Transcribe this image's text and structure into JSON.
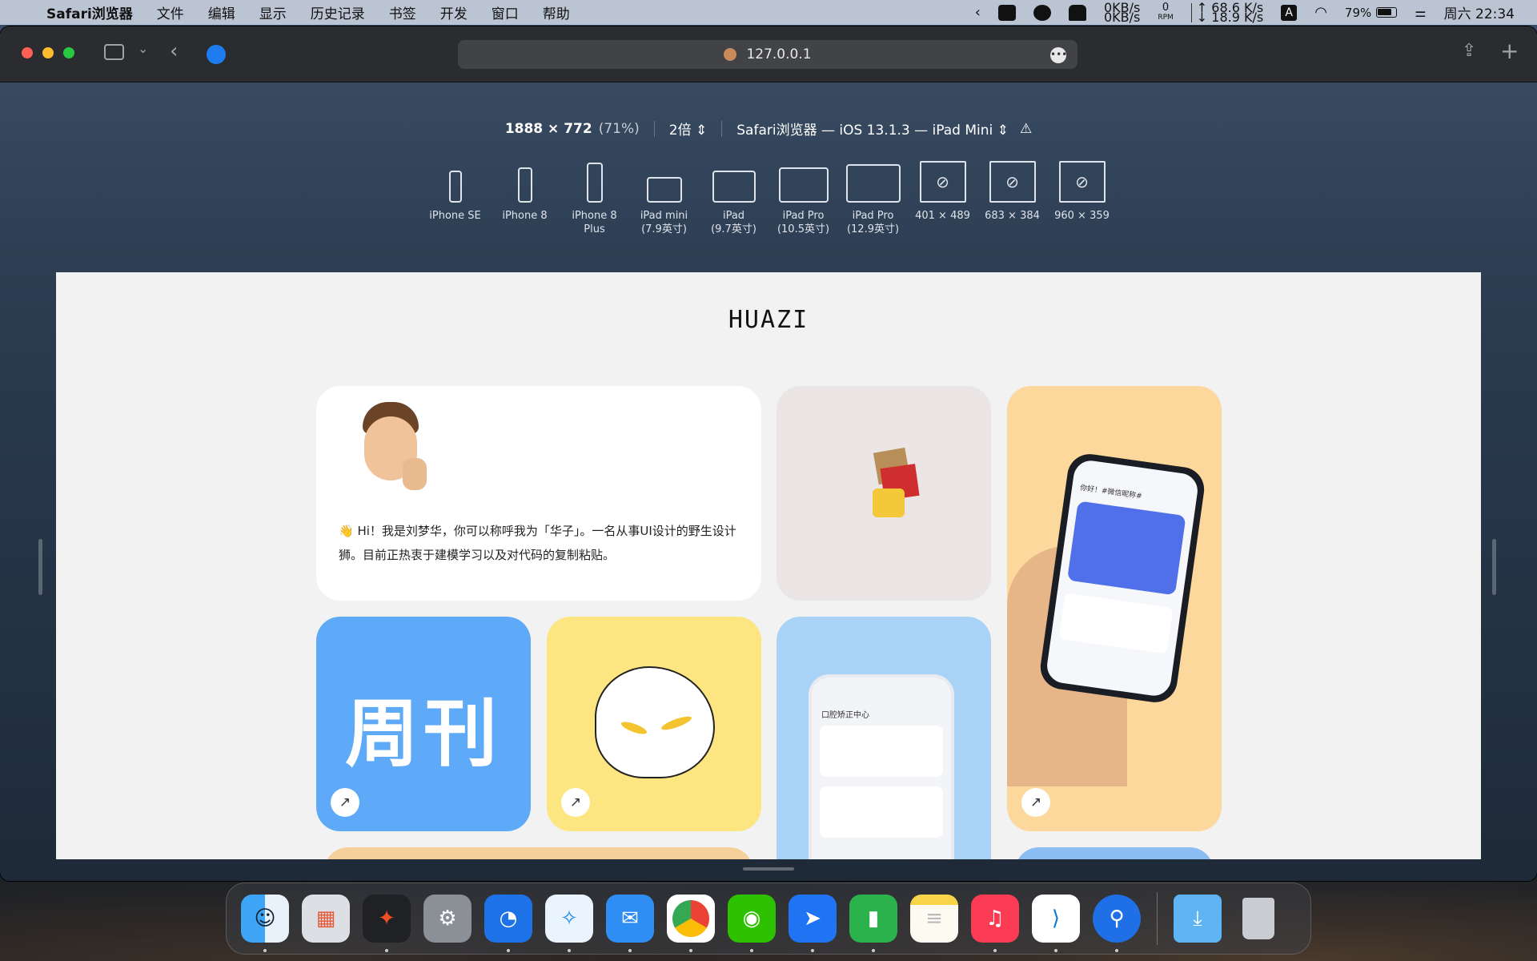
{
  "menubar": {
    "app_name": "Safari浏览器",
    "items": [
      "文件",
      "编辑",
      "显示",
      "历史记录",
      "书签",
      "开发",
      "窗口",
      "帮助"
    ],
    "net_up": "0KB/s",
    "net_down": "0KB/s",
    "fan_value": "0",
    "fan_unit": "RPM",
    "speed_up": "↑ 68.6 K/s",
    "speed_down": "↓ 18.9 K/s",
    "input_method": "A",
    "battery": "79%",
    "clock": "周六 22:34"
  },
  "toolbar": {
    "address": "127.0.0.1"
  },
  "responsive": {
    "dimensions": "1888 × 772",
    "zoom": "(71%)",
    "scale": "2倍",
    "user_agent": "Safari浏览器 — iOS 13.1.3 — iPad Mini",
    "devices": [
      {
        "line1": "iPhone SE",
        "line2": ""
      },
      {
        "line1": "iPhone 8",
        "line2": ""
      },
      {
        "line1": "iPhone 8",
        "line2": "Plus"
      },
      {
        "line1": "iPad mini",
        "line2": "(7.9英寸)"
      },
      {
        "line1": "iPad",
        "line2": "(9.7英寸)"
      },
      {
        "line1": "iPad Pro",
        "line2": "(10.5英寸)"
      },
      {
        "line1": "iPad Pro",
        "line2": "(12.9英寸)"
      },
      {
        "line1": "401 × 489",
        "line2": ""
      },
      {
        "line1": "683 × 384",
        "line2": ""
      },
      {
        "line1": "960 × 359",
        "line2": ""
      }
    ]
  },
  "page": {
    "logo": "HUAZI",
    "intro": "👋 Hi！我是刘梦华，你可以称呼我为「华子」。一名从事UI设计的野生设计狮。目前正热衷于建模学习以及对代码的复制粘贴。",
    "weekly_label": "周刊",
    "mock_title": "口腔矫正中心",
    "phone_greeting": "你好！#微信昵称#"
  },
  "dock": {
    "apps": [
      "Finder",
      "Launchpad",
      "Figma",
      "系统偏好设置",
      "Edge",
      "Safari浏览器",
      "邮件",
      "Chrome",
      "微信",
      "飞书",
      "Numbers",
      "备忘录",
      "音乐",
      "VS Code",
      "Maps",
      "下载",
      "废纸篓"
    ]
  },
  "colors": {
    "card_blue": "#5eaaf8",
    "card_yellow": "#fde581",
    "card_orange": "#fcd89c",
    "card_lightblue": "#a8d3f6",
    "card_pink": "#ebe5e6"
  }
}
